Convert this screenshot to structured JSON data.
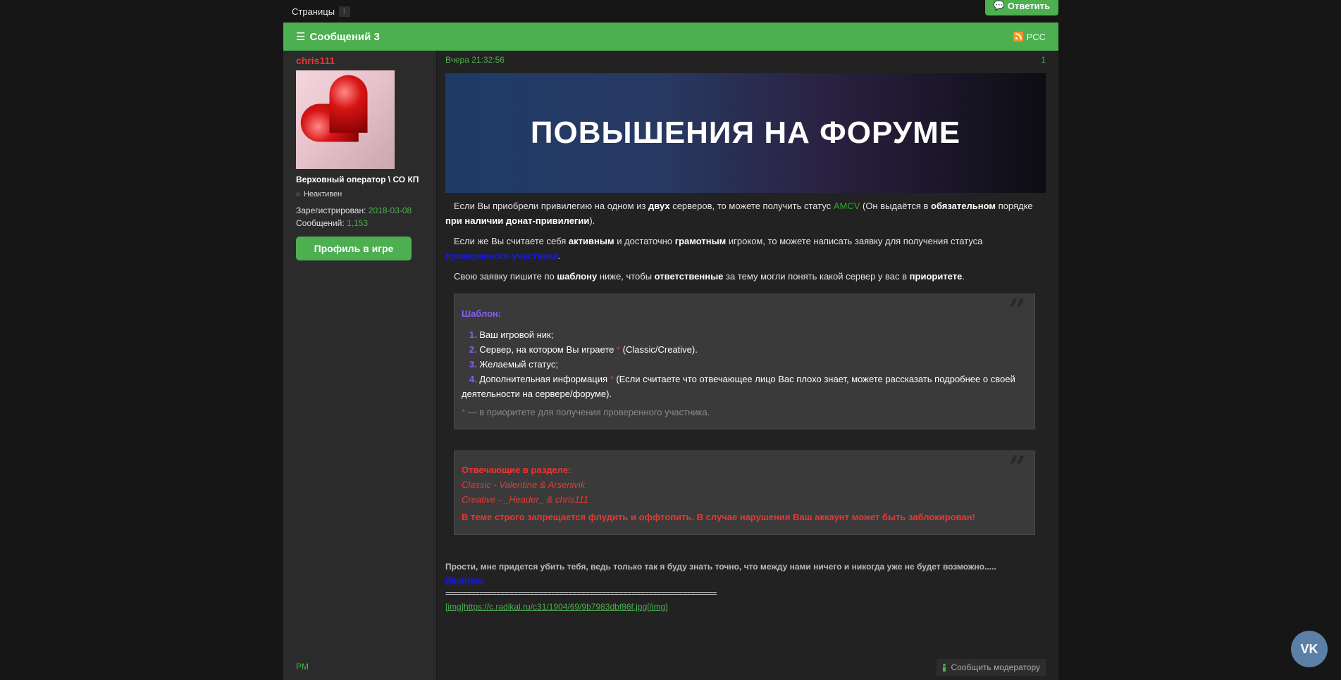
{
  "topbar": {
    "pages_label": "Страницы",
    "page_num": "1",
    "reply_label": "Ответить"
  },
  "header": {
    "title": "Сообщений 3",
    "rss_label": "РСС"
  },
  "author": {
    "name": "chris111",
    "rank": "Верховный оператор \\ СО КП",
    "status": "Неактивен",
    "registered_label": "Зарегистрирован:",
    "registered_value": "2018-03-08",
    "posts_label": "Сообщений:",
    "posts_value": "1,153",
    "profile_button": "Профиль в игре",
    "pm_label": "PM"
  },
  "post": {
    "time": "Вчера 21:32:56",
    "number": "1",
    "banner_text": "ПОВЫШЕНИЯ НА ФОРУМЕ",
    "p1": {
      "a": "Если Вы приобрели привилегию на одном из ",
      "b1": "двух",
      "c": " серверов, то можете получить статус ",
      "amcv": "AMCV",
      "d": " (Он выдаётся в ",
      "b2": "обязательном",
      "e": " порядке ",
      "b3": "при наличии донат-привилегии",
      "f": ")."
    },
    "p2": {
      "a": "Если же Вы считаете себя ",
      "b1": "активным",
      "c": " и достаточно ",
      "b2": "грамотным",
      "d": " игроком, то можете написать заявку для получения статуса ",
      "link": "проверенного участника",
      "e": "."
    },
    "p3": {
      "a": "Свою заявку пишите по ",
      "b1": "шаблону",
      "c": " ниже, чтобы ",
      "b2": "ответственные",
      "d": " за тему могли понять какой сервер у вас в ",
      "b3": "приоритете",
      "e": "."
    },
    "template": {
      "title": "Шаблон:",
      "items": [
        {
          "n": "1.",
          "text": "Ваш игровой ник;",
          "star": "",
          "rest": ""
        },
        {
          "n": "2.",
          "text": "Сервер, на котором Вы играете ",
          "star": "*",
          "rest": " (Classic/Creative)."
        },
        {
          "n": "3.",
          "text": "Желаемый статус;",
          "star": "",
          "rest": ""
        },
        {
          "n": "4.",
          "text": "Дополнительная информация ",
          "star": "*",
          "rest": " (Если считаете что отвечающее лицо Вас плохо знает, можете рассказать подробнее о своей деятельности на сервере/форуме)."
        }
      ],
      "note_star": "*",
      "note": " — в приоритете для получения проверенного участника."
    },
    "responders": {
      "title": "Отвечающие в разделе:",
      "classic": "Classic - Valentine & Arsenivik",
      "creative": "Creative - _Header_ & chris111",
      "warning": "В теме строго запрещается флудить и оффтопить. В случае нарушения Ваш аккаунт может быть заблокирован!"
    },
    "signature": {
      "line1": "Прости, мне придется убить тебя, ведь только так я буду знать точно, что между нами ничего и никогда уже не будет возможно.....",
      "line2": "Ивонтакс",
      "line3": "================================================================",
      "line4": "[img]https://c.radikal.ru/c31/1904/69/9b7983dbf86f.jpg[/img]"
    },
    "report_label": "Сообщить модератору"
  },
  "vk_label": "VK"
}
